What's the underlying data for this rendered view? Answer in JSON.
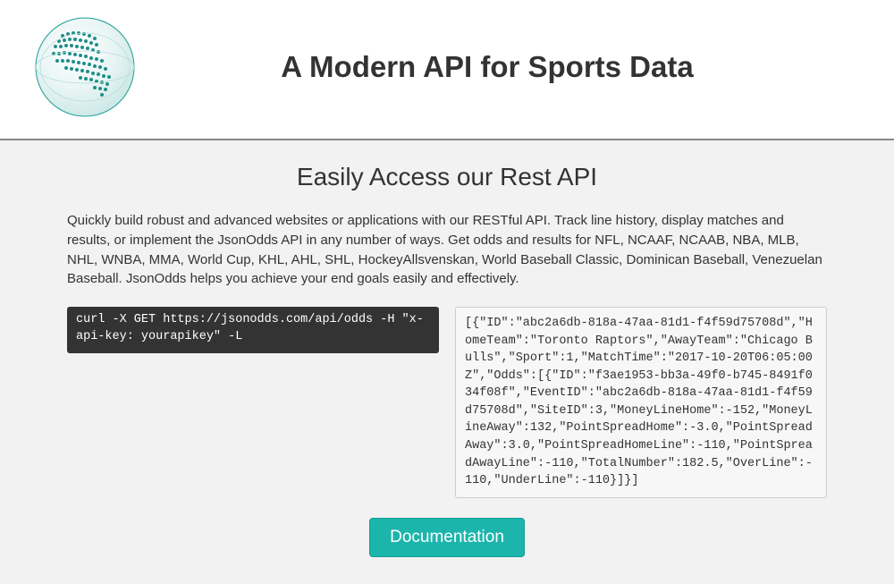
{
  "header": {
    "title": "A Modern API for Sports Data"
  },
  "main": {
    "subheading": "Easily Access our Rest API",
    "description": "Quickly build robust and advanced websites or applications with our RESTful API. Track line history, display matches and results, or implement the JsonOdds API in any number of ways. Get odds and results for NFL, NCAAF, NCAAB, NBA, MLB, NHL, WNBA, MMA, World Cup, KHL, AHL, SHL, HockeyAllsvenskan, World Baseball Classic, Dominican Baseball, Venezuelan Baseball. JsonOdds helps you achieve your end goals easily and effectively.",
    "curl_command": "curl -X GET https://jsonodds.com/api/odds -H \"x-api-key: yourapikey\" -L",
    "json_response": "[{\"ID\":\"abc2a6db-818a-47aa-81d1-f4f59d75708d\",\"HomeTeam\":\"Toronto Raptors\",\"AwayTeam\":\"Chicago Bulls\",\"Sport\":1,\"MatchTime\":\"2017-10-20T06:05:00Z\",\"Odds\":[{\"ID\":\"f3ae1953-bb3a-49f0-b745-8491f034f08f\",\"EventID\":\"abc2a6db-818a-47aa-81d1-f4f59d75708d\",\"SiteID\":3,\"MoneyLineHome\":-152,\"MoneyLineAway\":132,\"PointSpreadHome\":-3.0,\"PointSpreadAway\":3.0,\"PointSpreadHomeLine\":-110,\"PointSpreadAwayLine\":-110,\"TotalNumber\":182.5,\"OverLine\":-110,\"UnderLine\":-110}]}]",
    "button_label": "Documentation"
  }
}
